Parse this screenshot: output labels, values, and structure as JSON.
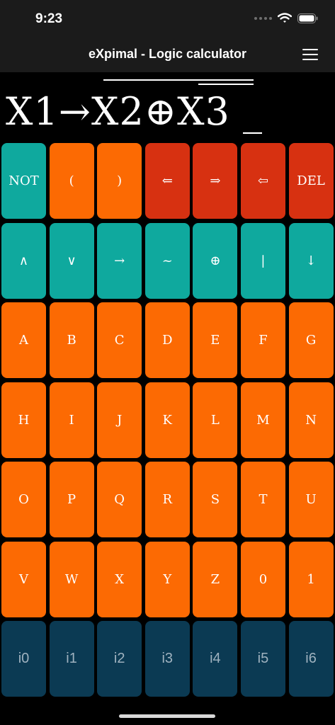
{
  "status_bar": {
    "time": "9:23",
    "icons": [
      "signal-dots-icon",
      "wifi-icon",
      "battery-icon"
    ]
  },
  "nav": {
    "title": "eXpimal - Logic calculator",
    "menu_icon": "hamburger-menu-icon"
  },
  "display": {
    "expression": "X1→X2⊕X3 _"
  },
  "colors": {
    "teal": "#0fa99e",
    "orange": "#fc6a03",
    "red": "#d73111",
    "navy": "#0b3a53",
    "bar": "#1b1b1b"
  },
  "keypad": {
    "rows": [
      [
        {
          "label": "NOT",
          "color": "teal"
        },
        {
          "label": "(",
          "color": "orange"
        },
        {
          "label": ")",
          "color": "orange"
        },
        {
          "label": "⇐",
          "color": "red"
        },
        {
          "label": "⇒",
          "color": "red"
        },
        {
          "label": "⇦",
          "color": "red"
        },
        {
          "label": "DEL",
          "color": "red"
        }
      ],
      [
        {
          "label": "∧",
          "color": "teal"
        },
        {
          "label": "∨",
          "color": "teal"
        },
        {
          "label": "→",
          "color": "teal"
        },
        {
          "label": "~",
          "color": "teal"
        },
        {
          "label": "⊕",
          "color": "teal"
        },
        {
          "label": "|",
          "color": "teal"
        },
        {
          "label": "↓",
          "color": "teal"
        }
      ],
      [
        {
          "label": "A",
          "color": "orange"
        },
        {
          "label": "B",
          "color": "orange"
        },
        {
          "label": "C",
          "color": "orange"
        },
        {
          "label": "D",
          "color": "orange"
        },
        {
          "label": "E",
          "color": "orange"
        },
        {
          "label": "F",
          "color": "orange"
        },
        {
          "label": "G",
          "color": "orange"
        }
      ],
      [
        {
          "label": "H",
          "color": "orange"
        },
        {
          "label": "I",
          "color": "orange"
        },
        {
          "label": "J",
          "color": "orange"
        },
        {
          "label": "K",
          "color": "orange"
        },
        {
          "label": "L",
          "color": "orange"
        },
        {
          "label": "M",
          "color": "orange"
        },
        {
          "label": "N",
          "color": "orange"
        }
      ],
      [
        {
          "label": "O",
          "color": "orange"
        },
        {
          "label": "P",
          "color": "orange"
        },
        {
          "label": "Q",
          "color": "orange"
        },
        {
          "label": "R",
          "color": "orange"
        },
        {
          "label": "S",
          "color": "orange"
        },
        {
          "label": "T",
          "color": "orange"
        },
        {
          "label": "U",
          "color": "orange"
        }
      ],
      [
        {
          "label": "V",
          "color": "orange"
        },
        {
          "label": "W",
          "color": "orange"
        },
        {
          "label": "X",
          "color": "orange"
        },
        {
          "label": "Y",
          "color": "orange"
        },
        {
          "label": "Z",
          "color": "orange"
        },
        {
          "label": "0",
          "color": "orange"
        },
        {
          "label": "1",
          "color": "orange"
        }
      ],
      [
        {
          "label": "i0",
          "color": "navy"
        },
        {
          "label": "i1",
          "color": "navy"
        },
        {
          "label": "i2",
          "color": "navy"
        },
        {
          "label": "i3",
          "color": "navy"
        },
        {
          "label": "i4",
          "color": "navy"
        },
        {
          "label": "i5",
          "color": "navy"
        },
        {
          "label": "i6",
          "color": "navy"
        }
      ]
    ]
  }
}
